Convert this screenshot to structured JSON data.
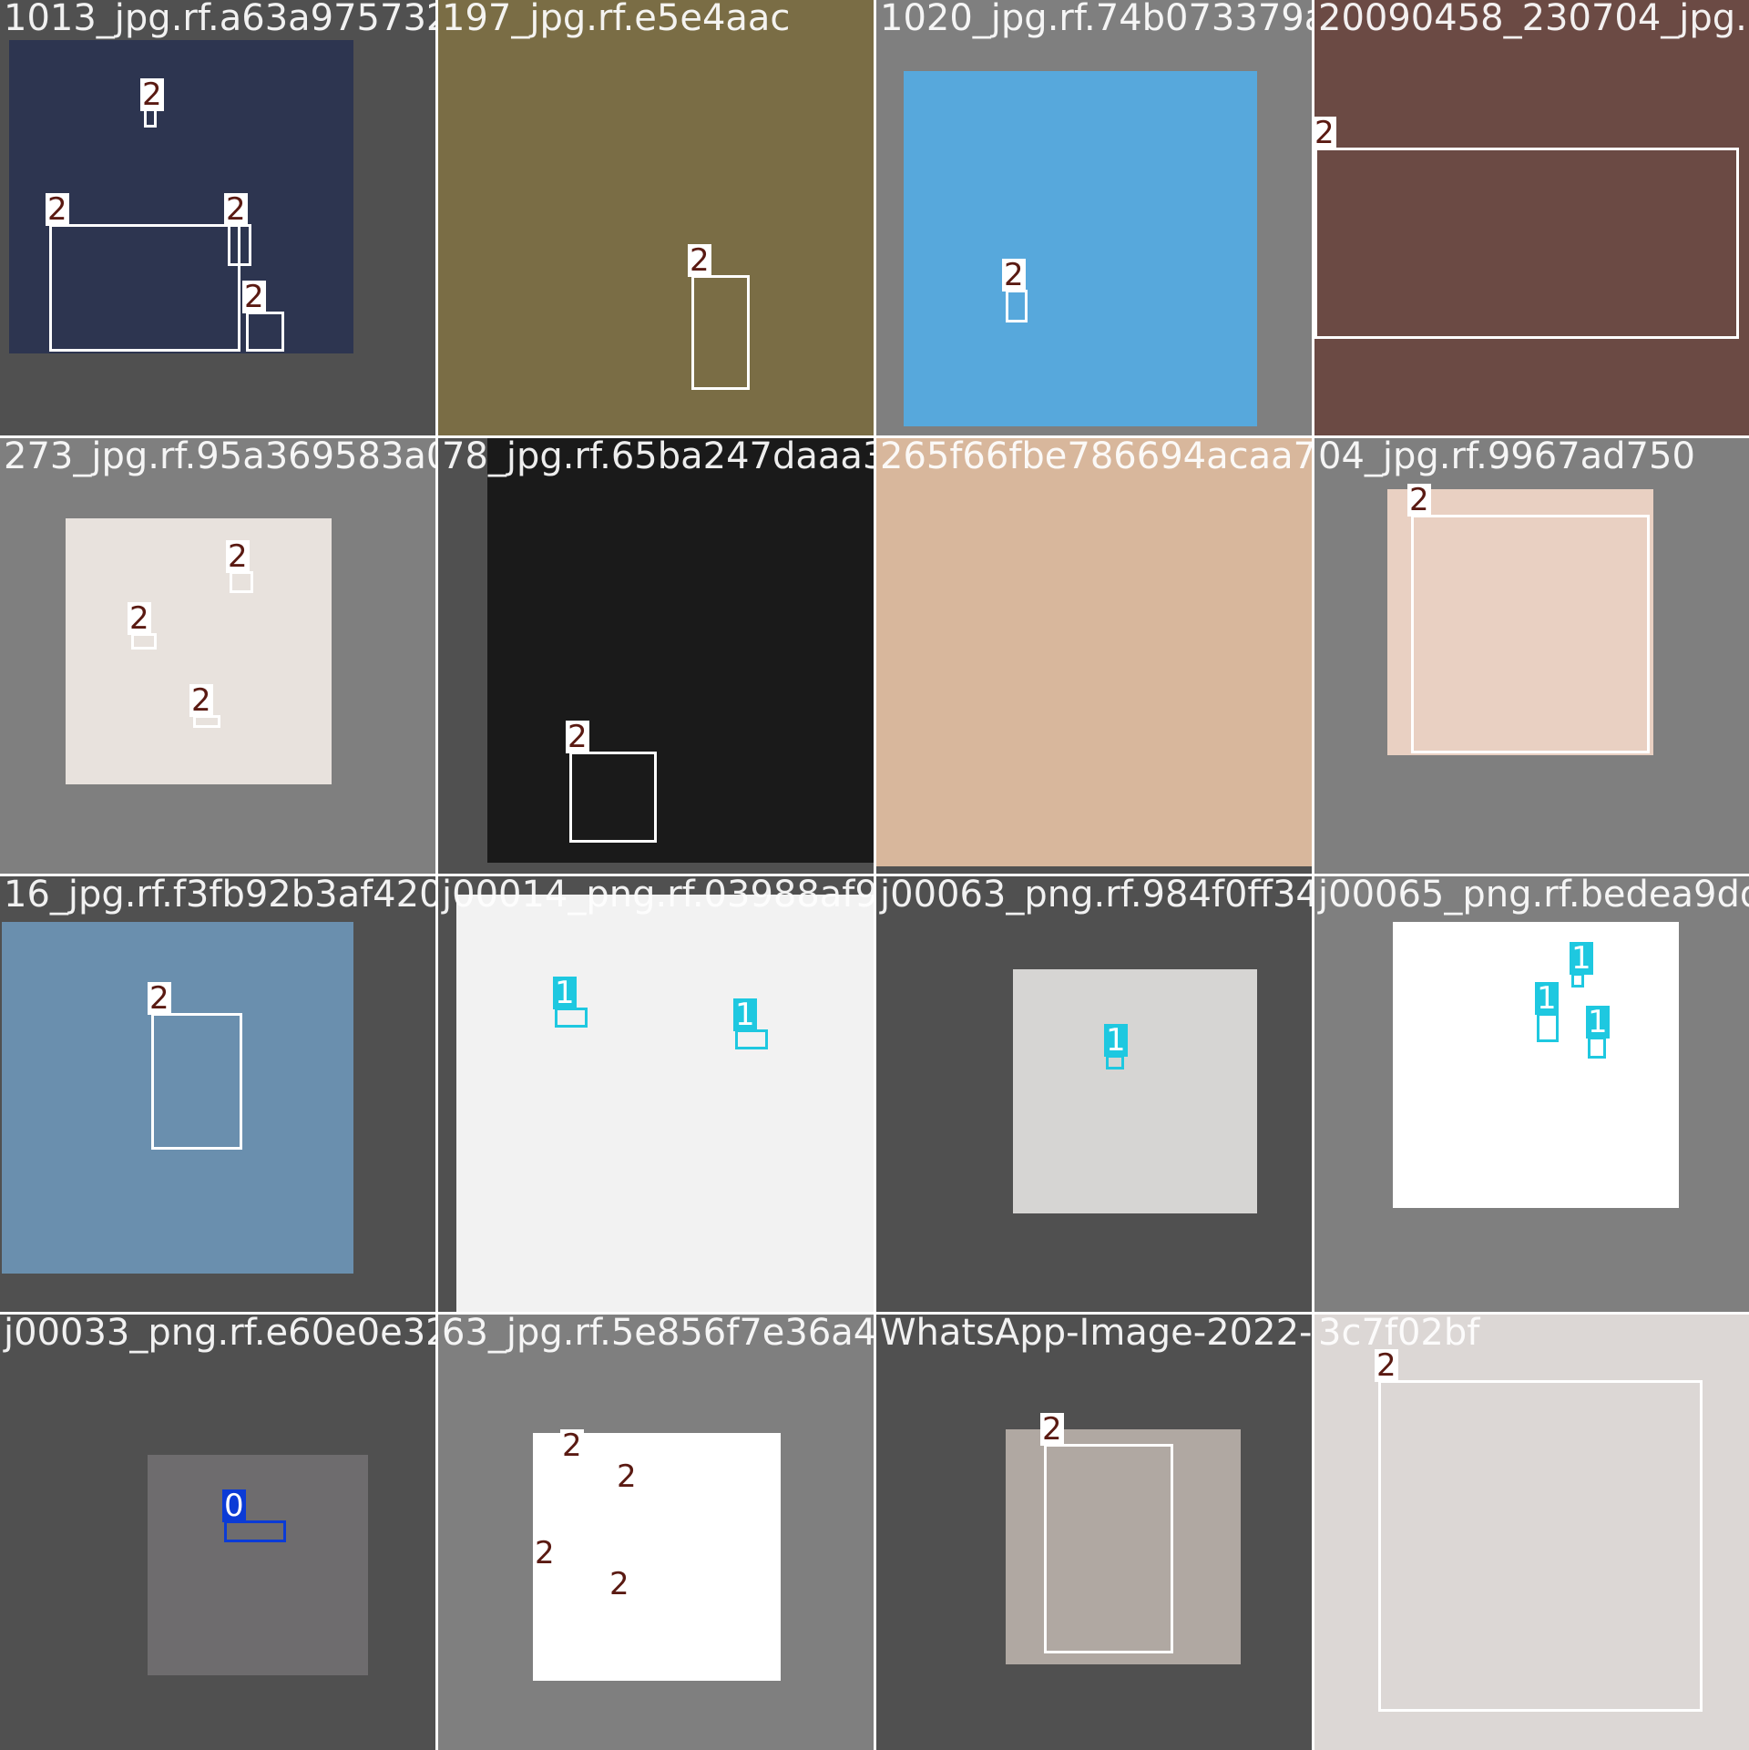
{
  "mosaic": {
    "tiles": [
      {
        "filename": "1013_jpg.rf.a63a9757328a5293f812bcf964737c939d8716",
        "labels": [
          "2",
          "2",
          "2",
          "2"
        ],
        "bg": "#505050",
        "photo_color": "#2d3550"
      },
      {
        "filename": "197_jpg.rf.e5e4aac",
        "labels": [
          "2"
        ],
        "bg": "#7f7f7f",
        "photo_color": "#7a6d45"
      },
      {
        "filename": "1020_jpg.rf.74b073379aa62f",
        "labels": [
          "2"
        ],
        "bg": "#7f7f7f",
        "photo_color": "#57a8dc"
      },
      {
        "filename": "20090458_230704_jpg.rf.dc",
        "labels": [
          "2"
        ],
        "bg": "#505050",
        "photo_color": "#6b4a44"
      },
      {
        "filename": "273_jpg.rf.95a369583a030583",
        "labels": [
          "2",
          "2",
          "2"
        ],
        "bg": "#7f7f7f",
        "photo_color": "#e8e2dd"
      },
      {
        "filename": "78_jpg.rf.65ba247daaa33dcc",
        "labels": [
          "2"
        ],
        "bg": "#505050",
        "photo_color": "#1a1a1a"
      },
      {
        "filename": "265f66fbe786694acaa7ed88b94f72e1",
        "labels": [],
        "bg": "#505050",
        "photo_color": "#d8b79c"
      },
      {
        "filename": "04_jpg.rf.9967ad750",
        "labels": [
          "2"
        ],
        "bg": "#7f7f7f",
        "photo_color": "#e9d0c2"
      },
      {
        "filename": "16_jpg.rf.f3fb92b3af420413",
        "labels": [
          "2"
        ],
        "bg": "#505050",
        "photo_color": "#6a8fae"
      },
      {
        "filename": "j00014_png.rf.03988af9edd",
        "labels": [
          "1",
          "1"
        ],
        "bg": "#505050",
        "photo_color": "#f2f2f2"
      },
      {
        "filename": "j00063_png.rf.984f0ff34c042",
        "labels": [
          "1"
        ],
        "bg": "#505050",
        "photo_color": "#d6d5d3"
      },
      {
        "filename": "j00065_png.rf.bedea9dd940",
        "labels": [
          "1",
          "1",
          "1"
        ],
        "bg": "#7f7f7f",
        "photo_color": "#ffffff"
      },
      {
        "filename": "j00033_png.rf.e60e0e324cc9",
        "labels": [
          "0"
        ],
        "bg": "#505050",
        "photo_color": "#6e6c6e"
      },
      {
        "filename": "63_jpg.rf.5e856f7e36a487",
        "labels": [
          "2",
          "2",
          "2",
          "2"
        ],
        "bg": "#7f7f7f",
        "photo_color": "#ffffff"
      },
      {
        "filename": "WhatsApp-Image-2022-11-20",
        "labels": [
          "2"
        ],
        "bg": "#505050",
        "photo_color": "#b0a8a2"
      },
      {
        "filename": "3c7f02bf",
        "labels": [
          "2"
        ],
        "bg": "#505050",
        "photo_color": "#dcd7d5"
      }
    ]
  }
}
